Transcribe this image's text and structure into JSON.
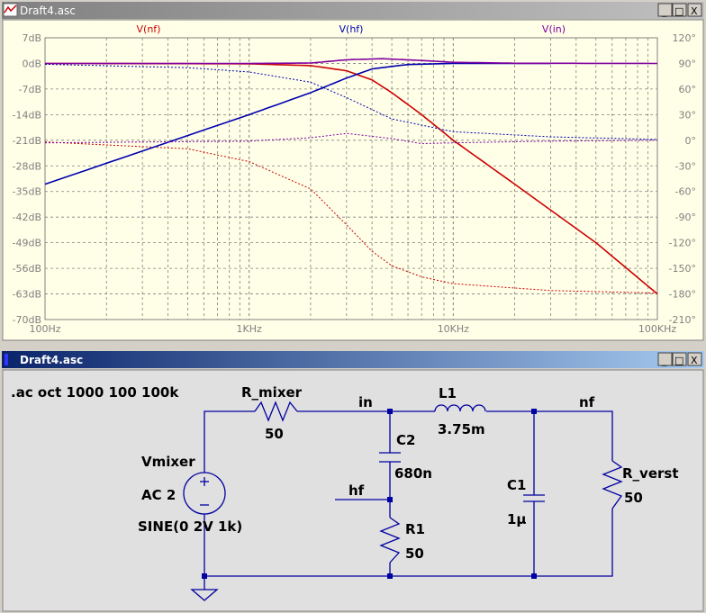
{
  "plot_window": {
    "title": "Draft4.asc",
    "buttons": [
      "_",
      "□",
      "X"
    ]
  },
  "schematic_window": {
    "title": "Draft4.asc",
    "buttons": [
      "_",
      "□",
      "X"
    ]
  },
  "chart_data": {
    "type": "line",
    "xscale": "log",
    "xlim": [
      100,
      100000
    ],
    "x_ticks": [
      "100Hz",
      "1KHz",
      "10KHz",
      "100KHz"
    ],
    "ylim_left": [
      -70,
      7
    ],
    "y_ticks_left": [
      "7dB",
      "0dB",
      "-7dB",
      "-14dB",
      "-21dB",
      "-28dB",
      "-35dB",
      "-42dB",
      "-49dB",
      "-56dB",
      "-63dB",
      "-70dB"
    ],
    "ylim_right": [
      -210,
      120
    ],
    "y_ticks_right": [
      "120°",
      "90°",
      "60°",
      "30°",
      "0°",
      "-30°",
      "-60°",
      "-90°",
      "-120°",
      "-150°",
      "-180°",
      "-210°"
    ],
    "grid": true,
    "legend": [
      "V(nf)",
      "V(hf)",
      "V(in)"
    ],
    "series": [
      {
        "name": "V(nf)",
        "color": "#cc0000",
        "kind": "magnitude_dB",
        "x": [
          100,
          1000,
          2000,
          3000,
          4000,
          5000,
          7000,
          10000,
          20000,
          50000,
          100000
        ],
        "y": [
          0,
          -0.1,
          -0.6,
          -2,
          -4.5,
          -8,
          -14,
          -21,
          -33,
          -49,
          -63
        ]
      },
      {
        "name": "V(nf)",
        "color": "#cc0000",
        "kind": "phase_deg",
        "x": [
          100,
          500,
          1000,
          2000,
          3000,
          4000,
          5000,
          7000,
          10000,
          30000,
          100000
        ],
        "y": [
          -2,
          -10,
          -25,
          -57,
          -99,
          -130,
          -147,
          -160,
          -168,
          -176,
          -179
        ]
      },
      {
        "name": "V(hf)",
        "color": "#0000b0",
        "kind": "magnitude_dB",
        "x": [
          100,
          1000,
          2000,
          3000,
          4000,
          6000,
          10000,
          30000
        ],
        "y": [
          -33,
          -14,
          -8,
          -4,
          -1.5,
          -0.3,
          0,
          0
        ]
      },
      {
        "name": "V(hf)",
        "color": "#0000b0",
        "kind": "phase_deg",
        "x": [
          100,
          500,
          1000,
          2000,
          3000,
          5000,
          10000,
          30000,
          100000
        ],
        "y": [
          89,
          85,
          80,
          68,
          50,
          25,
          10,
          4,
          1
        ]
      },
      {
        "name": "V(in)",
        "color": "#8000a0",
        "kind": "magnitude_dB",
        "x": [
          100,
          1000,
          2000,
          3000,
          4500,
          7000,
          10000,
          20000,
          100000
        ],
        "y": [
          0,
          0,
          0.1,
          1,
          1.3,
          0.8,
          0.3,
          0.05,
          0
        ]
      },
      {
        "name": "V(in)",
        "color": "#8000a0",
        "kind": "phase_deg",
        "x": [
          100,
          1000,
          2000,
          3000,
          5000,
          7000,
          10000,
          30000,
          100000
        ],
        "y": [
          -3,
          -1,
          3,
          8,
          2,
          -4,
          -3,
          -1,
          0
        ]
      }
    ]
  },
  "schematic": {
    "directive": ".ac oct 1000 100 100k",
    "r_mixer": {
      "name": "R_mixer",
      "value": "50"
    },
    "l1": {
      "name": "L1",
      "value": "3.75m"
    },
    "c2": {
      "name": "C2",
      "value": "680n"
    },
    "r1": {
      "name": "R1",
      "value": "50"
    },
    "c1": {
      "name": "C1",
      "value": "1µ"
    },
    "r_verst": {
      "name": "R_verst",
      "value": "50"
    },
    "vmixer": {
      "name": "Vmixer",
      "ac": "AC 2",
      "value": "SINE(0 2V 1k)"
    },
    "nets": {
      "in": "in",
      "nf": "nf",
      "hf": "hf"
    }
  }
}
